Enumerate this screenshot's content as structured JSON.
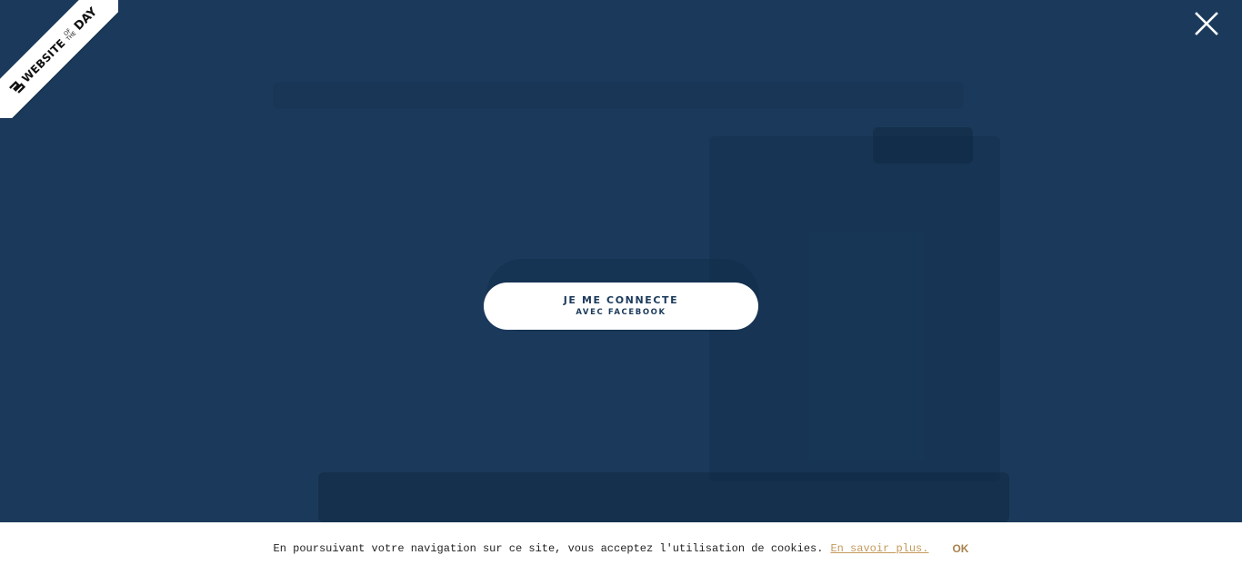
{
  "ribbon": {
    "website": "WEBSITE",
    "of": "OF",
    "the": "THE",
    "day": "DAY",
    "logo_icon": "awwwards-logo-icon"
  },
  "close": {
    "icon": "close-icon"
  },
  "connect": {
    "line1": "JE ME CONNECTE",
    "line2": "AVEC FACEBOOK"
  },
  "cookie": {
    "text": "En poursuivant votre navigation sur ce site, vous acceptez l'utilisation de cookies.",
    "link": "En savoir plus.",
    "ok": "OK"
  },
  "colors": {
    "overlay": "#1b3a5b",
    "button_bg": "#ffffff",
    "button_text": "#1b3a5b",
    "link": "#c49a5c",
    "ok": "#a8834f"
  }
}
